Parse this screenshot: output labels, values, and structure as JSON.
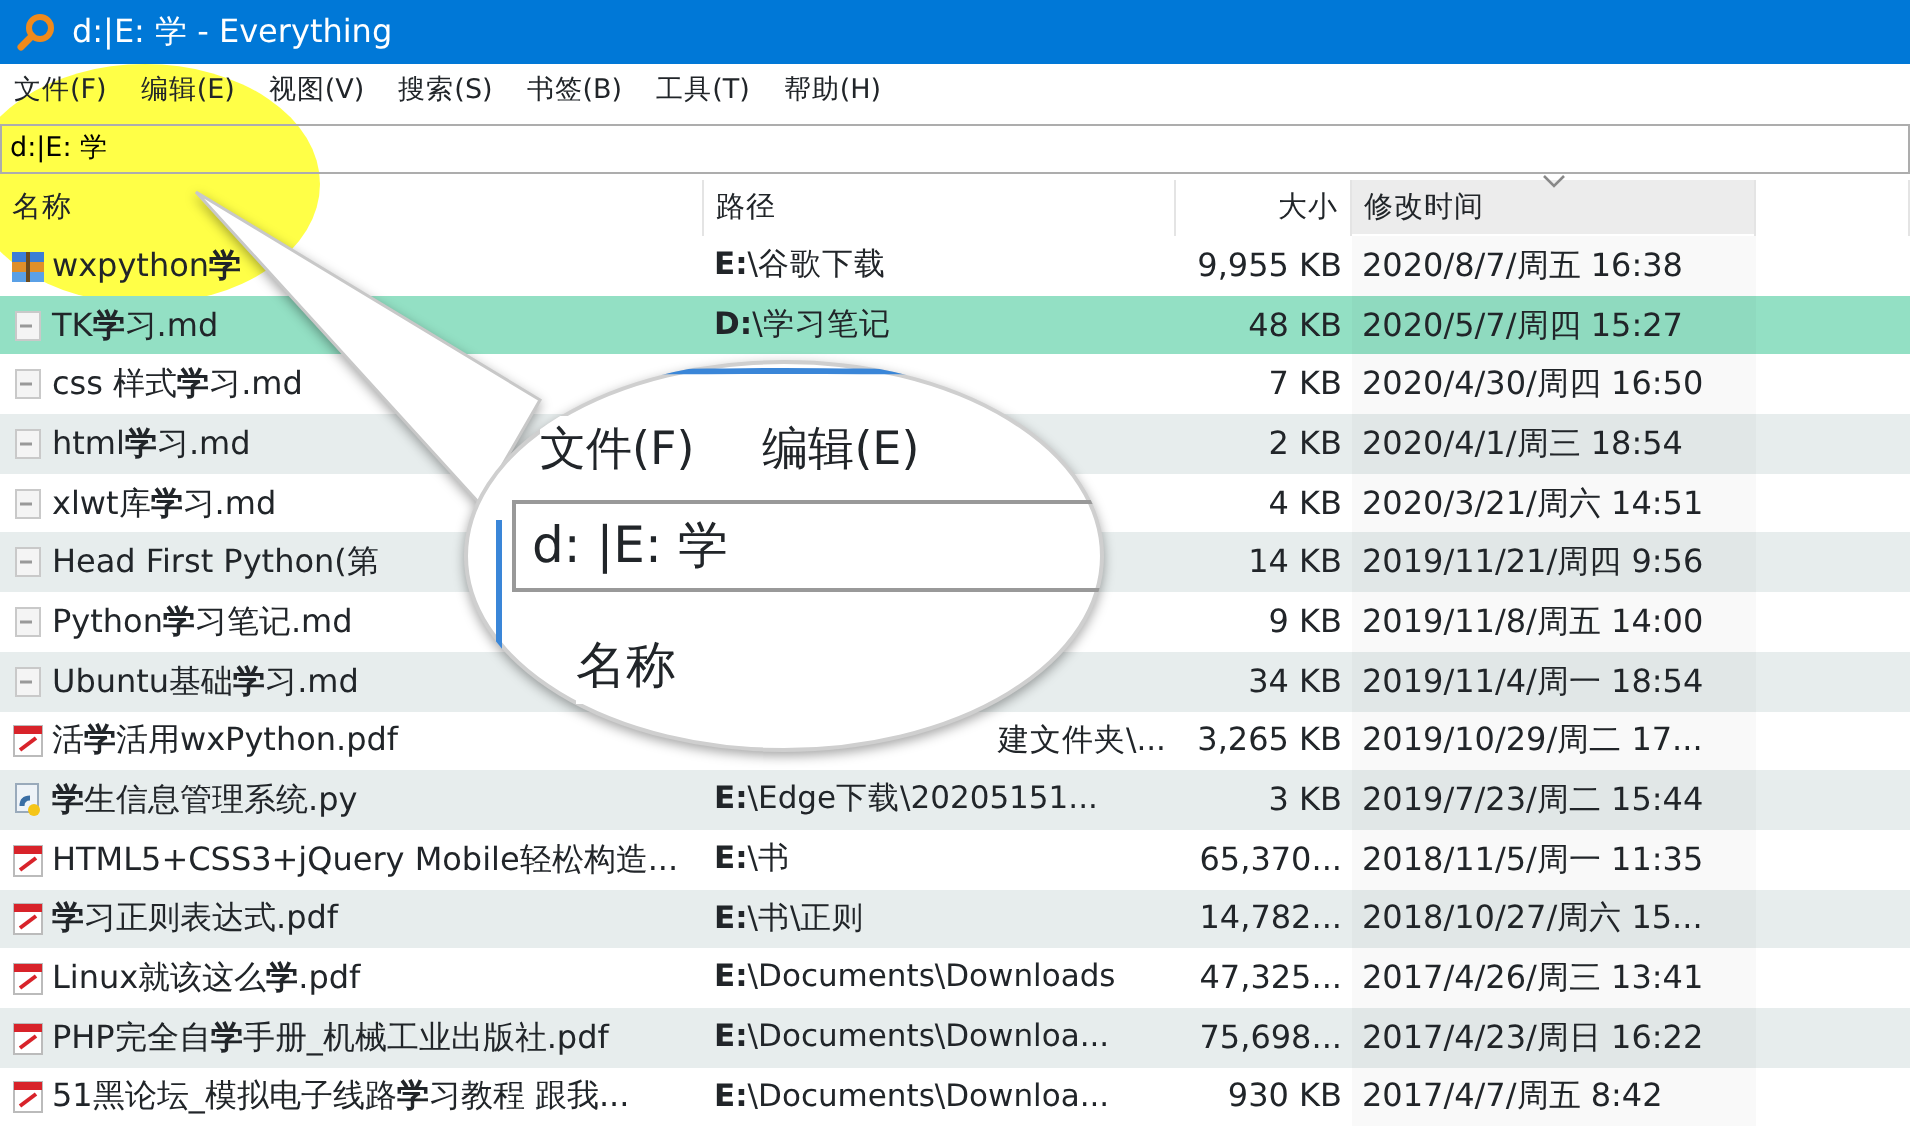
{
  "window": {
    "title": "d:|E: 学 - Everything"
  },
  "menu": [
    "文件(F)",
    "编辑(E)",
    "视图(V)",
    "搜索(S)",
    "书签(B)",
    "工具(T)",
    "帮助(H)"
  ],
  "search": {
    "value": "d:|E: 学"
  },
  "columns": [
    {
      "label": "名称",
      "sorted": false
    },
    {
      "label": "路径",
      "sorted": false
    },
    {
      "label": "大小",
      "sorted": false
    },
    {
      "label": "修改时间",
      "sorted": true
    }
  ],
  "rows": [
    {
      "kind": "zip",
      "name": "wxpython**学**",
      "path": "**E:**\\谷歌下载",
      "size": "9,955 KB",
      "modified": "2020/8/7/周五 16:38",
      "selected": false
    },
    {
      "kind": "md",
      "name": "TK**学**习.md",
      "path": "**D:**\\学习笔记",
      "size": "48 KB",
      "modified": "2020/5/7/周四 15:27",
      "selected": true
    },
    {
      "kind": "md",
      "name": "css 样式**学**习.md",
      "size": "7 KB",
      "modified": "2020/4/30/周四 16:50",
      "selected": false
    },
    {
      "kind": "md",
      "name": "html**学**习.md",
      "size": "2 KB",
      "modified": "2020/4/1/周三 18:54",
      "selected": false
    },
    {
      "kind": "md",
      "name": "xlwt库**学**习.md",
      "size": "4 KB",
      "modified": "2020/3/21/周六 14:51",
      "selected": false
    },
    {
      "kind": "md",
      "name": "Head First Python(第",
      "size": "14 KB",
      "modified": "2019/11/21/周四 9:56",
      "selected": false
    },
    {
      "kind": "md",
      "name": "Python**学**习笔记.md",
      "size": "9 KB",
      "modified": "2019/11/8/周五 14:00",
      "selected": false
    },
    {
      "kind": "md",
      "name": "Ubuntu基础**学**习.md",
      "size": "34 KB",
      "modified": "2019/11/4/周一 18:54",
      "selected": false
    },
    {
      "kind": "pdf",
      "name": "活**学**活用wxPython.pdf",
      "path": "建文件夹\\...",
      "path_cut": true,
      "size": "3,265 KB",
      "modified": "2019/10/29/周二 17...",
      "selected": false
    },
    {
      "kind": "py",
      "name": "**学**生信息管理系统.py",
      "path": "**E:**\\Edge下载\\20205151...",
      "size": "3 KB",
      "modified": "2019/7/23/周二 15:44",
      "selected": false
    },
    {
      "kind": "pdf",
      "name": "HTML5+CSS3+jQuery Mobile轻松构造...",
      "path": "**E:**\\书",
      "size": "65,370...",
      "modified": "2018/11/5/周一 11:35",
      "selected": false
    },
    {
      "kind": "pdf",
      "name": "**学**习正则表达式.pdf",
      "path": "**E:**\\书\\正则",
      "size": "14,782...",
      "modified": "2018/10/27/周六 15...",
      "selected": false
    },
    {
      "kind": "pdf",
      "name": "Linux就该这么**学**.pdf",
      "path": "**E:**\\Documents\\Downloads",
      "size": "47,325...",
      "modified": "2017/4/26/周三 13:41",
      "selected": false
    },
    {
      "kind": "pdf",
      "name": "PHP完全自**学**手册_机械工业出版社.pdf",
      "path": "**E:**\\Documents\\Downloa...",
      "size": "75,698...",
      "modified": "2017/4/23/周日 16:22",
      "selected": false
    },
    {
      "kind": "pdf",
      "name": "51黑论坛_模拟电子线路**学**习教程 跟我...",
      "path": "**E:**\\Documents\\Downloa...",
      "size": "930 KB",
      "modified": "2017/4/7/周五 8:42",
      "selected": false
    }
  ],
  "callout": {
    "menu": [
      "文件(F)",
      "编辑(E)"
    ],
    "search_value": "d: |E: 学",
    "column_label": "名称"
  }
}
